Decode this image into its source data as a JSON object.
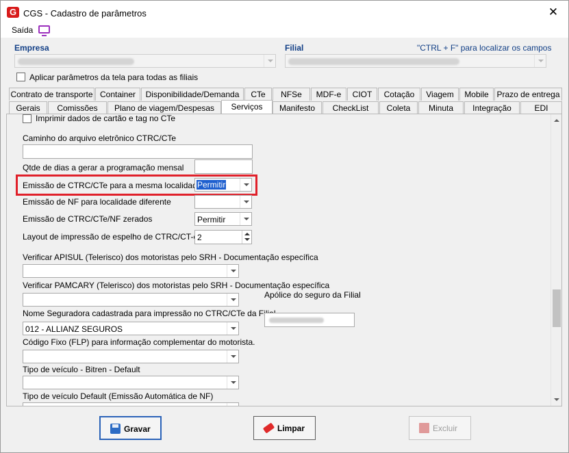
{
  "window": {
    "title": "CGS - Cadastro de parâmetros",
    "close": "✕"
  },
  "menu": {
    "saida": "Saída"
  },
  "header": {
    "empresa_label": "Empresa",
    "filial_label": "Filial",
    "hint": "\"CTRL + F\" para localizar os campos",
    "apply_all_label": "Aplicar parâmetros da tela para todas as filiais"
  },
  "tabs_row1": [
    "Contrato de transporte",
    "Container",
    "Disponibilidade/Demanda",
    "CTe",
    "NFSe",
    "MDF-e",
    "CIOT",
    "Cotação",
    "Viagem",
    "Mobile",
    "Prazo de entrega"
  ],
  "tabs_row2": [
    "Gerais",
    "Comissões",
    "Plano de viagem/Despesas",
    "Serviços",
    "Manifesto",
    "CheckList",
    "Coleta",
    "Minuta",
    "Integração",
    "EDI"
  ],
  "active_tab": "Serviços",
  "form": {
    "imprimir_label": "Imprimir dados de cartão e tag no CTe",
    "caminho_label": "Caminho do arquivo eletrônico CTRC/CTe",
    "qtde_label": "Qtde de dias a gerar a programação mensal",
    "emissao_mesma_label": "Emissão de CTRC/CTe para a mesma localidade",
    "emissao_mesma_value": "Permitir",
    "emissao_nf_label": "Emissão de NF para localidade diferente",
    "emissao_zerados_label": "Emissão de CTRC/CTe/NF zerados",
    "emissao_zerados_value": "Permitir",
    "layout_label": "Layout de impressão de espelho de CTRC/CT-e",
    "layout_value": "2",
    "apisul_label": "Verificar APISUL (Telerisco) dos motoristas pelo SRH - Documentação específica",
    "pamcary_label": "Verificar PAMCARY (Telerisco) dos motoristas pelo SRH - Documentação específica",
    "apolice_label": "Apólice do seguro da Filial",
    "seguradora_label": "Nome Seguradora cadastrada para impressão no CTRC/CTe da Filial",
    "seguradora_value": "012 - ALLIANZ SEGUROS",
    "codigo_fixo_label": "Código Fixo (FLP) para informação complementar do motorista.",
    "tipo_bitren_label": "Tipo de veículo - Bitren - Default",
    "tipo_default_label": "Tipo de veículo Default (Emissão Automática de NF)"
  },
  "buttons": {
    "gravar": "Gravar",
    "limpar": "Limpar",
    "excluir": "Excluir"
  },
  "colors": {
    "accent": "#123f86",
    "highlight": "#e0202a",
    "selection": "#1e5fcf"
  }
}
